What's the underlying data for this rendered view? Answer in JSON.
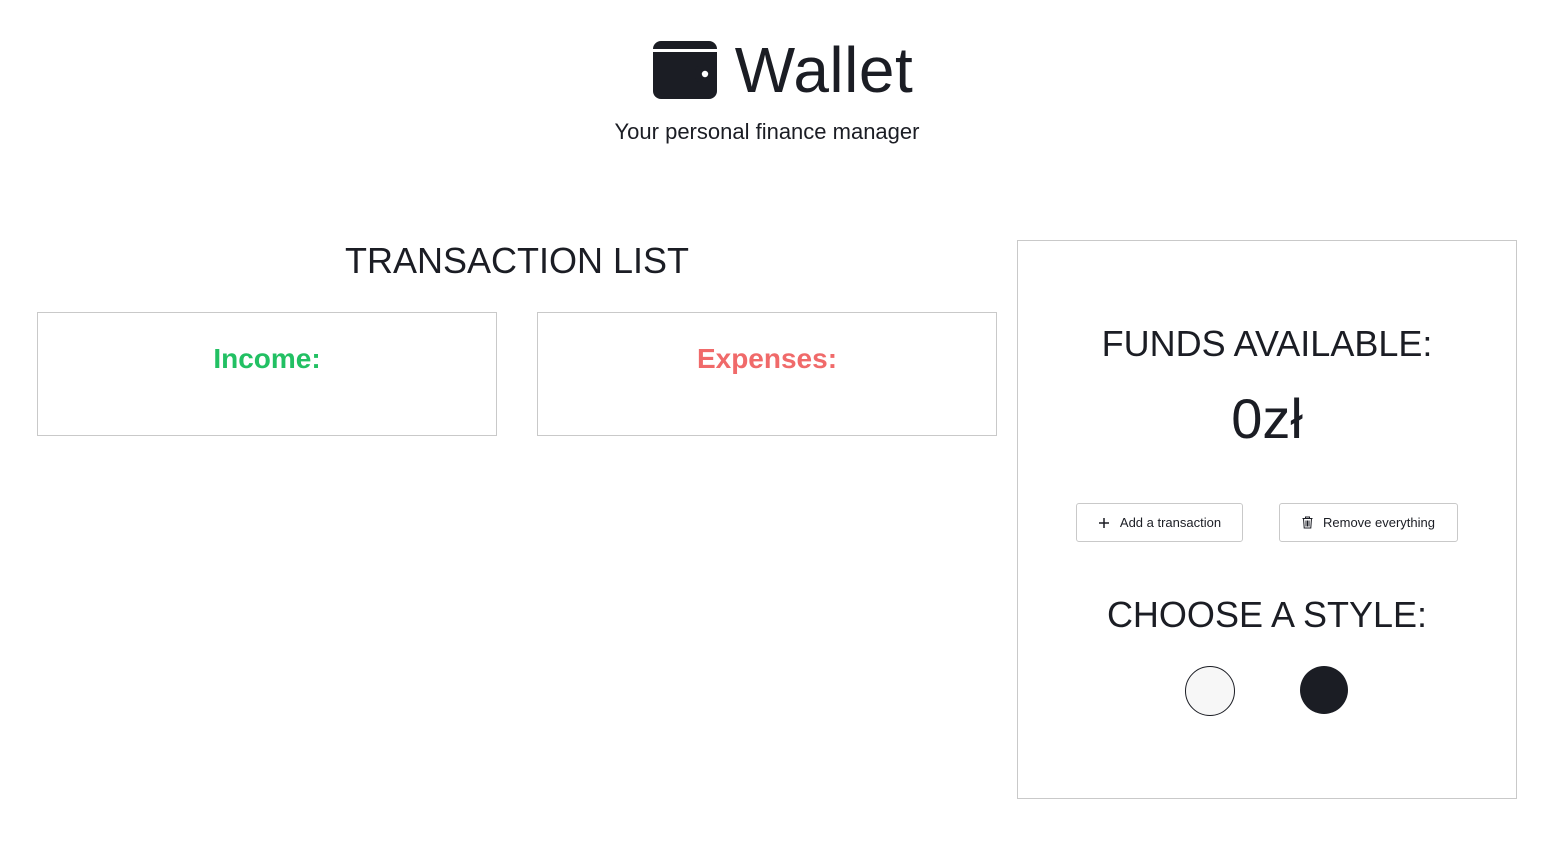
{
  "header": {
    "title": "Wallet",
    "subtitle": "Your personal finance manager",
    "icon": "wallet-icon"
  },
  "transactions": {
    "heading": "TRANSACTION LIST",
    "income_label": "Income:",
    "expenses_label": "Expenses:",
    "colors": {
      "income": "#22c063",
      "expenses": "#f06a6a"
    }
  },
  "summary": {
    "funds_label": "FUNDS AVAILABLE:",
    "funds_value": "0zł",
    "add_button": {
      "label": "Add a transaction",
      "icon": "plus-icon"
    },
    "remove_button": {
      "label": "Remove everything",
      "icon": "trash-icon"
    },
    "style_label": "CHOOSE A STYLE:",
    "styles": [
      {
        "name": "light",
        "color": "#f7f7f7"
      },
      {
        "name": "dark",
        "color": "#1b1d24"
      }
    ]
  }
}
